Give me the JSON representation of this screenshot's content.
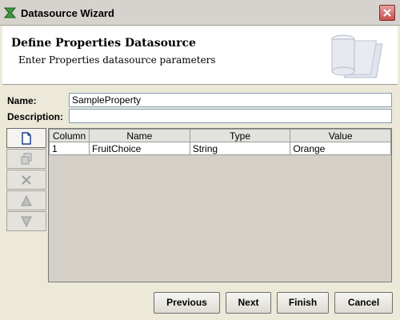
{
  "window": {
    "title": "Datasource Wizard"
  },
  "header": {
    "title": "Define Properties Datasource",
    "subtitle": "Enter Properties datasource parameters"
  },
  "form": {
    "name_label": "Name:",
    "name_value": "SampleProperty",
    "description_label": "Description:",
    "description_value": ""
  },
  "table": {
    "columns": [
      "Column",
      "Name",
      "Type",
      "Value"
    ],
    "rows": [
      [
        "1",
        "FruitChoice",
        "String",
        "Orange"
      ]
    ]
  },
  "toolbar": {
    "icons": [
      "new-row-icon",
      "copy-row-icon",
      "delete-row-icon",
      "move-up-icon",
      "move-down-icon"
    ]
  },
  "buttons": {
    "previous": "Previous",
    "next": "Next",
    "finish": "Finish",
    "cancel": "Cancel"
  },
  "colors": {
    "window_bg": "#ece9d8",
    "field_border": "#7f9db9",
    "close_button": "#c85050"
  }
}
